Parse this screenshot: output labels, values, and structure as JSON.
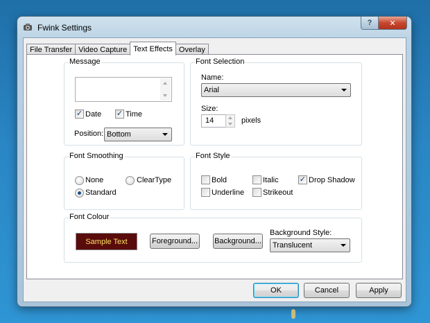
{
  "window": {
    "title": "Fwink Settings",
    "help_glyph": "?",
    "close_glyph": "✕"
  },
  "tabs": [
    "File Transfer",
    "Video Capture",
    "Text Effects",
    "Overlay"
  ],
  "active_tab": "Text Effects",
  "message": {
    "label": "Message",
    "text": "",
    "date_label": "Date",
    "date_checked": true,
    "time_label": "Time",
    "time_checked": true,
    "position_label": "Position:",
    "position_value": "Bottom"
  },
  "font_selection": {
    "label": "Font Selection",
    "name_label": "Name:",
    "name_value": "Arial",
    "size_label": "Size:",
    "size_value": "14",
    "size_unit": "pixels"
  },
  "font_smoothing": {
    "label": "Font Smoothing",
    "none_label": "None",
    "cleartype_label": "ClearType",
    "standard_label": "Standard",
    "selected": "Standard"
  },
  "font_style": {
    "label": "Font Style",
    "bold_label": "Bold",
    "bold": false,
    "italic_label": "Italic",
    "italic": false,
    "drop_shadow_label": "Drop Shadow",
    "drop_shadow": true,
    "underline_label": "Underline",
    "underline": false,
    "strikeout_label": "Strikeout",
    "strikeout": false
  },
  "font_colour": {
    "label": "Font Colour",
    "sample_text": "Sample Text",
    "sample_bg": "#5a0b0b",
    "sample_fg": "#ffe266",
    "foreground_button": "Foreground...",
    "background_button": "Background...",
    "background_style_label": "Background Style:",
    "background_style_value": "Translucent"
  },
  "footer": {
    "ok": "OK",
    "cancel": "Cancel",
    "apply": "Apply"
  },
  "colors": {
    "desktop": "#2a86c4",
    "check": "#1d3f7a"
  }
}
